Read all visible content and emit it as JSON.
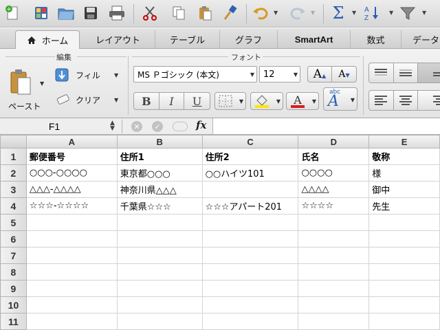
{
  "toolbar": {
    "icons": [
      "new-icon",
      "gallery-icon",
      "open-icon",
      "save-icon",
      "print-icon",
      "cut-icon",
      "copy-icon",
      "paste-icon",
      "format-painter-icon",
      "undo-icon",
      "redo-icon",
      "autosum-icon",
      "sort-icon",
      "filter-icon"
    ]
  },
  "tabs": [
    {
      "label": "ホーム",
      "active": true
    },
    {
      "label": "レイアウト"
    },
    {
      "label": "テーブル"
    },
    {
      "label": "グラフ"
    },
    {
      "label": "SmartArt"
    },
    {
      "label": "数式"
    },
    {
      "label": "データ"
    }
  ],
  "ribbon": {
    "edit_group": "編集",
    "font_group": "フォント",
    "paste_label": "ペースト",
    "fill_label": "フィル",
    "clear_label": "クリア",
    "font_name": "MS Ｐゴシック (本文)",
    "font_size": "12",
    "bold": "B",
    "italic": "I",
    "underline": "U",
    "abc": "abc",
    "font_color_hex": "#e01b1b",
    "fill_color_hex": "#ffe600"
  },
  "formula_bar": {
    "cell_ref": "F1",
    "fx": "fx",
    "value": ""
  },
  "grid": {
    "columns": [
      "A",
      "B",
      "C",
      "D",
      "E"
    ],
    "rows": [
      {
        "num": "1",
        "cells": [
          "郵便番号",
          "住所1",
          "住所2",
          "氏名",
          "敬称"
        ]
      },
      {
        "num": "2",
        "cells": [
          "○○○-○○○○",
          "東京都○○○",
          "○○ハイツ101",
          "○○○○",
          "様"
        ]
      },
      {
        "num": "3",
        "cells": [
          "△△△-△△△△",
          "神奈川県△△△",
          "",
          "△△△△",
          "御中"
        ]
      },
      {
        "num": "4",
        "cells": [
          "☆☆☆-☆☆☆☆",
          "千葉県☆☆☆",
          "☆☆☆アパート201",
          "☆☆☆☆",
          "先生"
        ]
      },
      {
        "num": "5",
        "cells": [
          "",
          "",
          "",
          "",
          ""
        ]
      },
      {
        "num": "6",
        "cells": [
          "",
          "",
          "",
          "",
          ""
        ]
      },
      {
        "num": "7",
        "cells": [
          "",
          "",
          "",
          "",
          ""
        ]
      },
      {
        "num": "8",
        "cells": [
          "",
          "",
          "",
          "",
          ""
        ]
      },
      {
        "num": "9",
        "cells": [
          "",
          "",
          "",
          "",
          ""
        ]
      },
      {
        "num": "10",
        "cells": [
          "",
          "",
          "",
          "",
          ""
        ]
      },
      {
        "num": "11",
        "cells": [
          "",
          "",
          "",
          "",
          ""
        ]
      }
    ]
  }
}
